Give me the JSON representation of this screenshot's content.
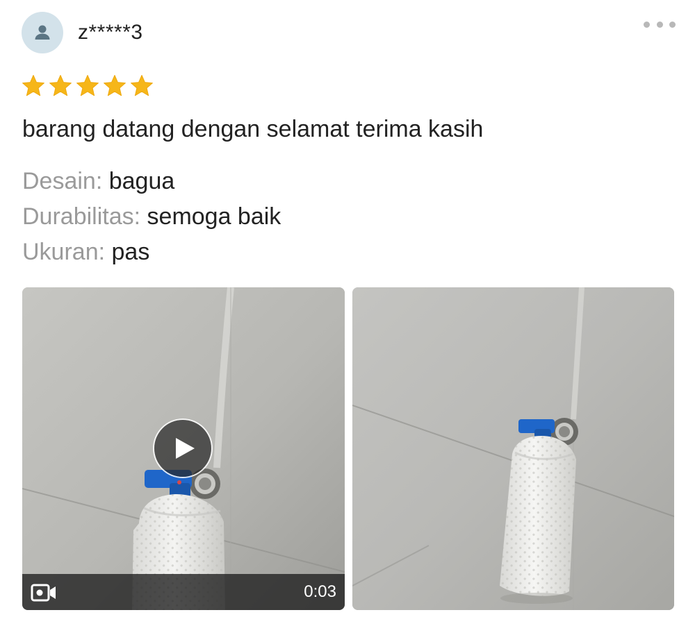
{
  "review": {
    "username": "z*****3",
    "rating": 5,
    "rating_max": 5,
    "text": "barang datang dengan selamat terima kasih",
    "attributes": [
      {
        "key": "Desain:",
        "value": "bagua"
      },
      {
        "key": "Durabilitas:",
        "value": "semoga baik"
      },
      {
        "key": "Ukuran:",
        "value": "pas"
      }
    ],
    "media": [
      {
        "type": "video",
        "duration": "0:03"
      },
      {
        "type": "photo"
      }
    ]
  },
  "icons": {
    "avatar": "user-icon",
    "more": "more-horizontal-icon",
    "star": "star-icon",
    "play": "play-icon",
    "video": "video-camera-icon"
  },
  "colors": {
    "star": "#f6b619",
    "avatar_bg": "#d3e2ea",
    "avatar_fg": "#5b7584",
    "muted_text": "#9a9a9a",
    "handle_blue": "#1f66c9"
  }
}
